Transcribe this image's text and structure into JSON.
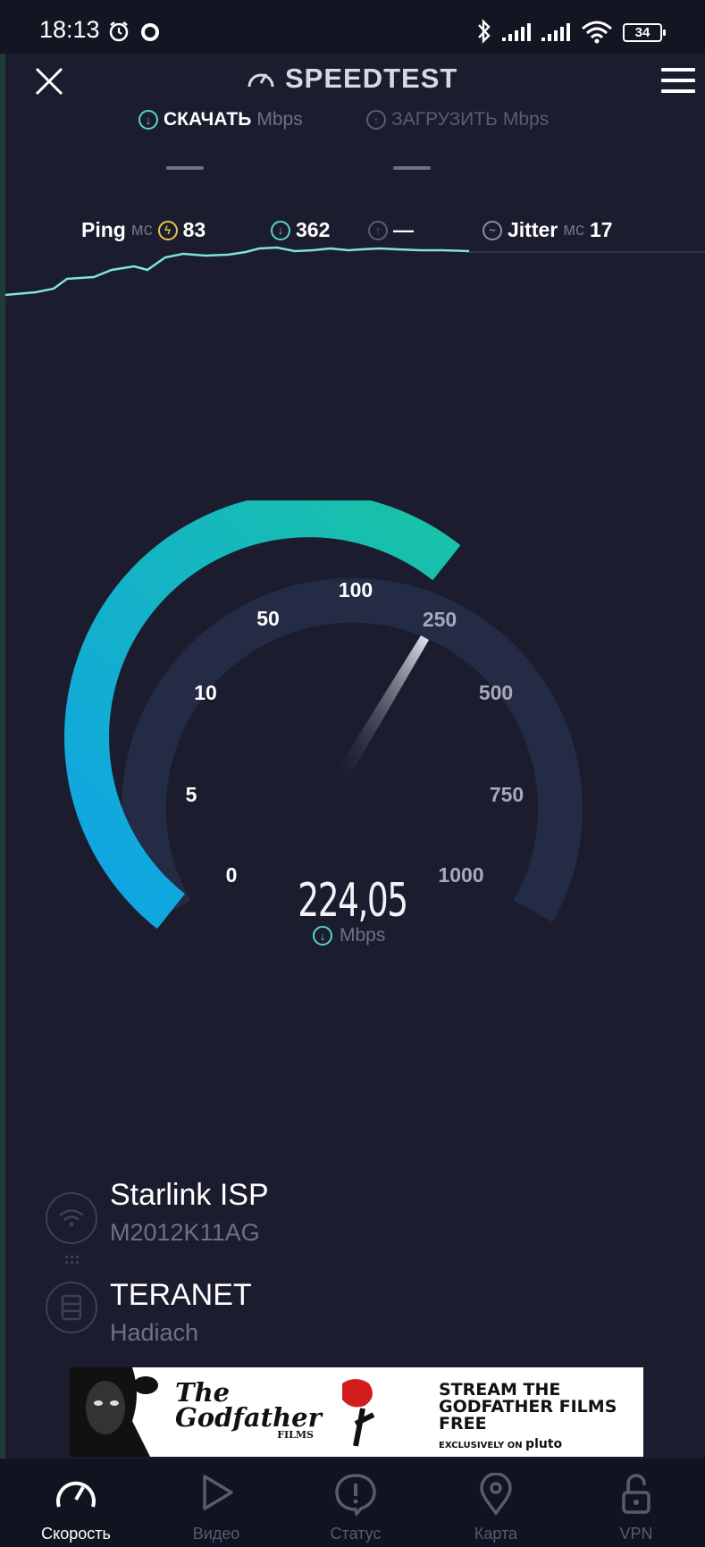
{
  "status_bar": {
    "time": "18:13",
    "battery": "34"
  },
  "header": {
    "title": "SPEEDTEST"
  },
  "tabs": {
    "download": {
      "label": "СКАЧАТЬ",
      "unit": "Mbps"
    },
    "upload": {
      "label": "ЗАГРУЗИТЬ",
      "unit": "Mbps"
    }
  },
  "metrics": {
    "ping_label": "Ping",
    "ping_unit": "мс",
    "ping_value": "83",
    "download_value": "362",
    "upload_value": "—",
    "jitter_label": "Jitter",
    "jitter_unit": "мс",
    "jitter_value": "17"
  },
  "gauge": {
    "ticks": [
      "0",
      "5",
      "10",
      "50",
      "100",
      "250",
      "500",
      "750",
      "1000"
    ],
    "reading": "224,05",
    "reading_unit": "Mbps",
    "colors": {
      "active_start": "#0fa4e6",
      "active_end": "#19c3a6",
      "inactive": "#232b45"
    }
  },
  "connection": {
    "isp": "Starlink ISP",
    "device": "M2012K11AG",
    "server": "TERANET",
    "server_location": "Hadiach"
  },
  "ad": {
    "brand": "The Godfather",
    "brand_sub": "FILMS",
    "headline": "STREAM THE GODFATHER FILMS FREE",
    "tagline": "EXCLUSIVELY ON",
    "tagline_brand": "pluto"
  },
  "nav": [
    {
      "label": "Скорость",
      "icon": "speedometer-icon"
    },
    {
      "label": "Видео",
      "icon": "play-icon"
    },
    {
      "label": "Статус",
      "icon": "alert-icon"
    },
    {
      "label": "Карта",
      "icon": "map-pin-icon"
    },
    {
      "label": "VPN",
      "icon": "lock-icon"
    }
  ]
}
